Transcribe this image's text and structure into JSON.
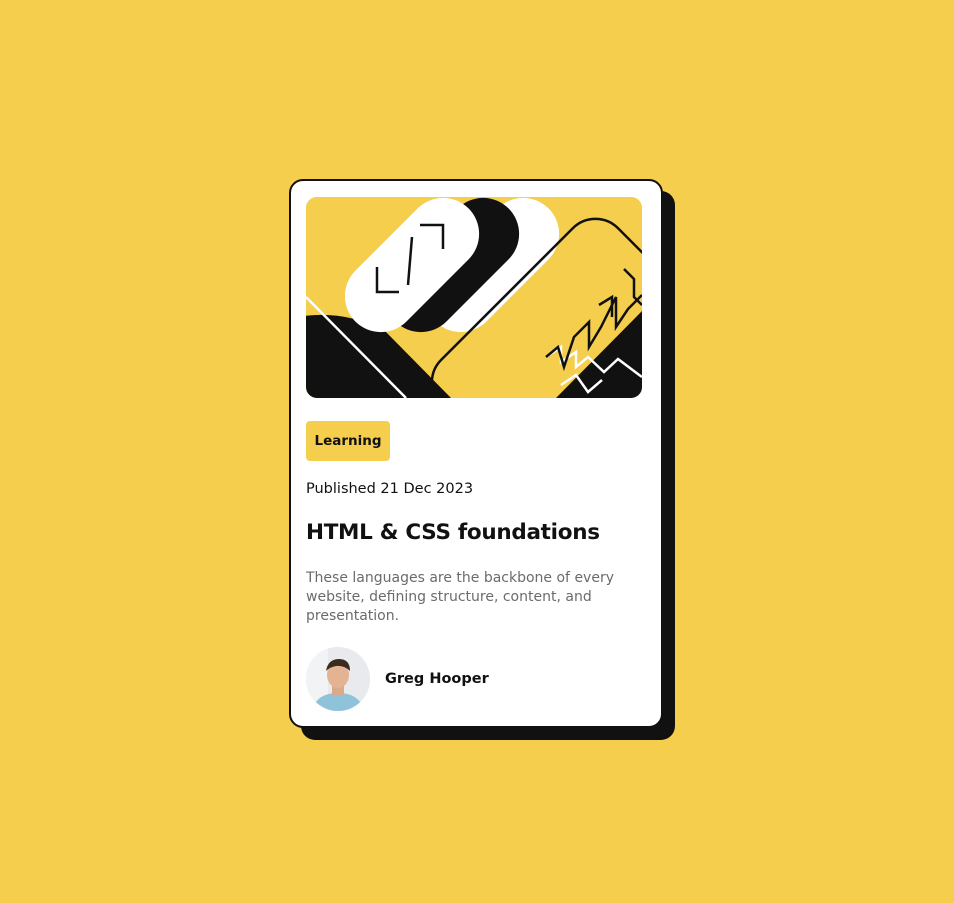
{
  "colors": {
    "background": "#F4CE4C",
    "card": "#FFFFFF",
    "ink": "#111111",
    "muted_text": "#6B6B6B"
  },
  "card": {
    "hero_image": "abstract-geometric-illustration",
    "tag_label": "Learning",
    "published": "Published 21 Dec 2023",
    "title": "HTML & CSS foundations",
    "description": "These languages are the backbone of every website, defining structure, content, and presentation.",
    "author": {
      "avatar": "author-avatar-photo",
      "name": "Greg Hooper"
    }
  }
}
